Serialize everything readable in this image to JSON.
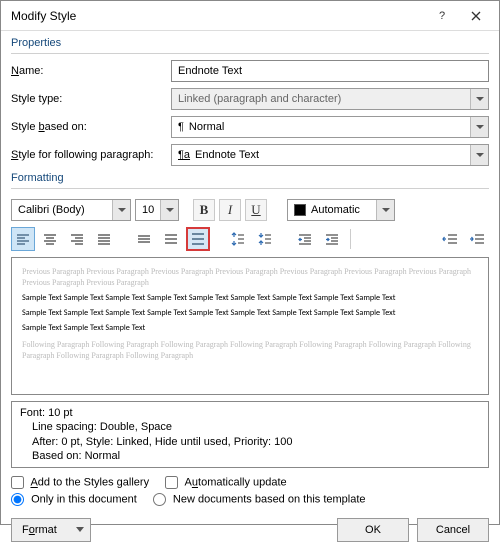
{
  "titlebar": {
    "title": "Modify Style"
  },
  "sections": {
    "properties": "Properties",
    "formatting": "Formatting"
  },
  "props": {
    "name_label": "Name:",
    "name_value": "Endnote Text",
    "styletype_label": "Style type:",
    "styletype_value": "Linked (paragraph and character)",
    "basedon_label": "Style based on:",
    "basedon_value": "Normal",
    "following_label": "Style for following paragraph:",
    "following_value": "Endnote Text"
  },
  "formatting": {
    "font": "Calibri (Body)",
    "size": "10",
    "bold": "B",
    "italic": "I",
    "underline": "U",
    "color_label": "Automatic"
  },
  "preview": {
    "ghost_prev": "Previous Paragraph Previous Paragraph Previous Paragraph Previous Paragraph Previous Paragraph Previous Paragraph Previous Paragraph Previous Paragraph Previous Paragraph",
    "sample1": "Sample Text Sample Text Sample Text Sample Text Sample Text Sample Text Sample Text Sample Text Sample Text",
    "sample2": "Sample Text Sample Text Sample Text Sample Text Sample Text Sample Text Sample Text Sample Text Sample Text",
    "sample3": "Sample Text Sample Text Sample Text",
    "ghost_foll": "Following Paragraph Following Paragraph Following Paragraph Following Paragraph Following Paragraph Following Paragraph Following Paragraph Following Paragraph Following Paragraph"
  },
  "desc": {
    "line1": "Font: 10 pt",
    "line2": "Line spacing:  Double, Space",
    "line3": "After:  0 pt, Style: Linked, Hide until used, Priority: 100",
    "line4": "Based on: Normal"
  },
  "opts": {
    "add_gallery": "Add to the Styles gallery",
    "auto_update": "Automatically update",
    "only_doc": "Only in this document",
    "new_docs": "New documents based on this template"
  },
  "buttons": {
    "format": "Format",
    "ok": "OK",
    "cancel": "Cancel"
  }
}
